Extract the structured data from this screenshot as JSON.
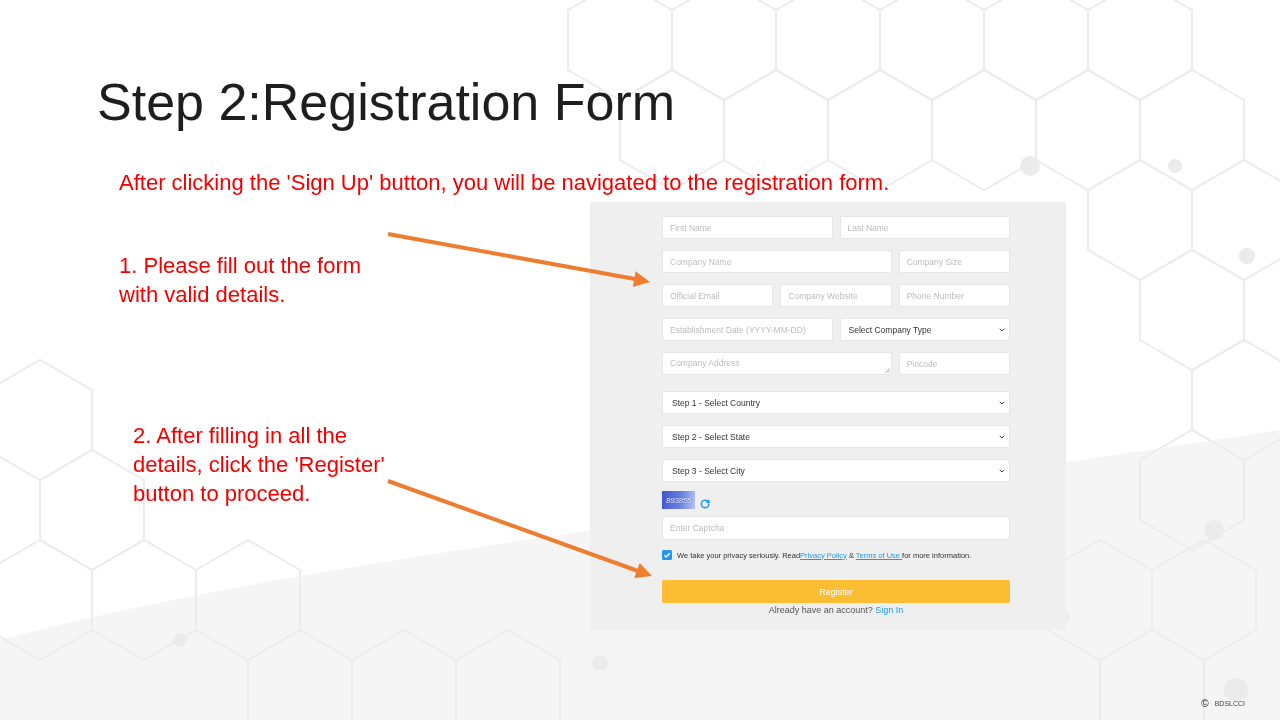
{
  "title": "Step 2:Registration Form",
  "intro": "After clicking the 'Sign Up' button, you will be navigated to the registration form.",
  "notes": [
    {
      "lines": [
        "1. Please fill out the form",
        "with valid details."
      ]
    },
    {
      "lines": [
        "2. After filling in all the",
        "details, click the 'Register'",
        "button to proceed."
      ]
    }
  ],
  "form": {
    "rows": [
      [
        {
          "kind": "input",
          "placeholder": "First Name"
        },
        {
          "kind": "input",
          "placeholder": "Last Name"
        }
      ],
      [
        {
          "kind": "input",
          "placeholder": "Company Name"
        },
        {
          "kind": "input",
          "placeholder": "Company Size"
        }
      ],
      [
        {
          "kind": "input",
          "placeholder": "Official Email"
        },
        {
          "kind": "input",
          "placeholder": "Company Website"
        },
        {
          "kind": "input",
          "placeholder": "Phone Number"
        }
      ],
      [
        {
          "kind": "input",
          "placeholder": "Establishment Date (YYYY-MM-DD)"
        },
        {
          "kind": "select",
          "value": "Select Company Type"
        }
      ],
      [
        {
          "kind": "textarea",
          "placeholder": "Company Address"
        },
        {
          "kind": "input",
          "placeholder": "Pincode"
        }
      ]
    ],
    "location_selects": [
      {
        "kind": "select",
        "value": "Step 1 - Select Country"
      },
      {
        "kind": "select",
        "value": "Step 2 - Select State"
      },
      {
        "kind": "select",
        "value": "Step 3 - Select City"
      }
    ],
    "captcha": {
      "code": "893855",
      "placeholder": "Enter Captcha"
    },
    "consent": {
      "checked": true,
      "parts": [
        {
          "kind": "text",
          "text": "We take your privacy seriously. Read"
        },
        {
          "kind": "link",
          "text": "Privacy Policy"
        },
        {
          "kind": "text",
          "text": " & "
        },
        {
          "kind": "link",
          "text": "Terms of Use "
        },
        {
          "kind": "text",
          "text": "for more information."
        }
      ]
    },
    "submit": "Register",
    "sign_in": {
      "text": "Already have an account?",
      "link": "Sign In"
    }
  },
  "footer": {
    "symbol": "©",
    "owner": "BDSLCCI"
  }
}
